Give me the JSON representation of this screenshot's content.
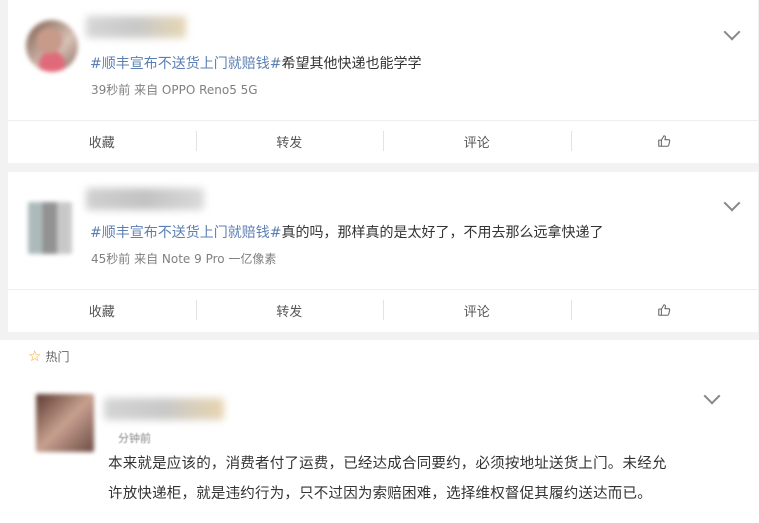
{
  "posts": [
    {
      "hashtag": "#顺丰宣布不送货上门就赔钱#",
      "text": "希望其他快递也能学学",
      "meta": "39秒前  来自 OPPO Reno5 5G"
    },
    {
      "hashtag": "#顺丰宣布不送货上门就赔钱#",
      "text": "真的吗，那样真的是太好了，不用去那么远拿快递了",
      "meta": "45秒前  来自 Note 9 Pro 一亿像素"
    }
  ],
  "actions": {
    "favorite": "收藏",
    "repost": "转发",
    "comment": "评论"
  },
  "hot": {
    "label": "热门",
    "time": "分钟前",
    "line1": "本来就是应该的，消费者付了运费，已经达成合同要约，必须按地址送货上门。未经允",
    "line2": "许放快递柜，就是违约行为，只不过因为索赔困难，选择维权督促其履约送达而已。"
  },
  "icons": {
    "like": "thumbs-up-icon",
    "expand": "chevron-down-icon",
    "hot": "star-icon"
  },
  "colors": {
    "hashtag": "#5b7fb3",
    "meta": "#808080",
    "star": "#f5a623"
  }
}
